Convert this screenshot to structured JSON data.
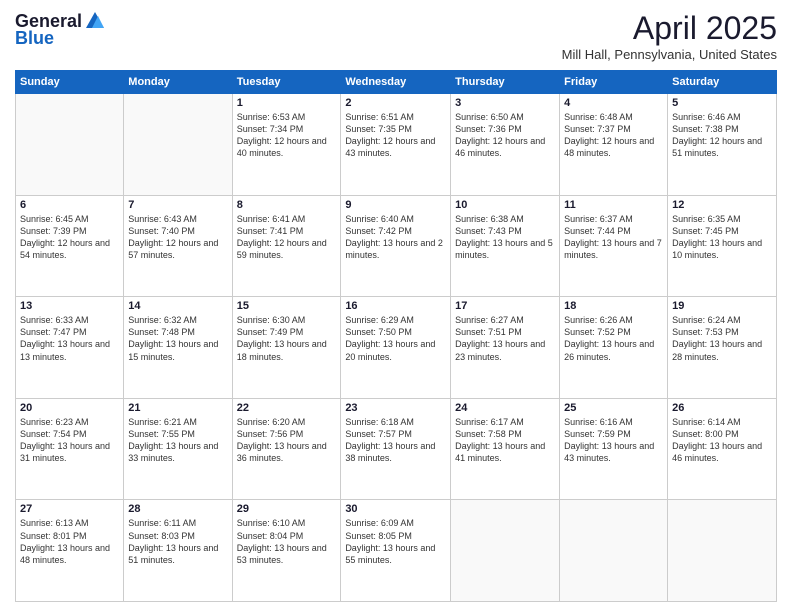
{
  "header": {
    "logo_line1": "General",
    "logo_line2": "Blue",
    "title": "April 2025",
    "subtitle": "Mill Hall, Pennsylvania, United States"
  },
  "days_of_week": [
    "Sunday",
    "Monday",
    "Tuesday",
    "Wednesday",
    "Thursday",
    "Friday",
    "Saturday"
  ],
  "weeks": [
    [
      {
        "day": "",
        "info": ""
      },
      {
        "day": "",
        "info": ""
      },
      {
        "day": "1",
        "info": "Sunrise: 6:53 AM\nSunset: 7:34 PM\nDaylight: 12 hours and 40 minutes."
      },
      {
        "day": "2",
        "info": "Sunrise: 6:51 AM\nSunset: 7:35 PM\nDaylight: 12 hours and 43 minutes."
      },
      {
        "day": "3",
        "info": "Sunrise: 6:50 AM\nSunset: 7:36 PM\nDaylight: 12 hours and 46 minutes."
      },
      {
        "day": "4",
        "info": "Sunrise: 6:48 AM\nSunset: 7:37 PM\nDaylight: 12 hours and 48 minutes."
      },
      {
        "day": "5",
        "info": "Sunrise: 6:46 AM\nSunset: 7:38 PM\nDaylight: 12 hours and 51 minutes."
      }
    ],
    [
      {
        "day": "6",
        "info": "Sunrise: 6:45 AM\nSunset: 7:39 PM\nDaylight: 12 hours and 54 minutes."
      },
      {
        "day": "7",
        "info": "Sunrise: 6:43 AM\nSunset: 7:40 PM\nDaylight: 12 hours and 57 minutes."
      },
      {
        "day": "8",
        "info": "Sunrise: 6:41 AM\nSunset: 7:41 PM\nDaylight: 12 hours and 59 minutes."
      },
      {
        "day": "9",
        "info": "Sunrise: 6:40 AM\nSunset: 7:42 PM\nDaylight: 13 hours and 2 minutes."
      },
      {
        "day": "10",
        "info": "Sunrise: 6:38 AM\nSunset: 7:43 PM\nDaylight: 13 hours and 5 minutes."
      },
      {
        "day": "11",
        "info": "Sunrise: 6:37 AM\nSunset: 7:44 PM\nDaylight: 13 hours and 7 minutes."
      },
      {
        "day": "12",
        "info": "Sunrise: 6:35 AM\nSunset: 7:45 PM\nDaylight: 13 hours and 10 minutes."
      }
    ],
    [
      {
        "day": "13",
        "info": "Sunrise: 6:33 AM\nSunset: 7:47 PM\nDaylight: 13 hours and 13 minutes."
      },
      {
        "day": "14",
        "info": "Sunrise: 6:32 AM\nSunset: 7:48 PM\nDaylight: 13 hours and 15 minutes."
      },
      {
        "day": "15",
        "info": "Sunrise: 6:30 AM\nSunset: 7:49 PM\nDaylight: 13 hours and 18 minutes."
      },
      {
        "day": "16",
        "info": "Sunrise: 6:29 AM\nSunset: 7:50 PM\nDaylight: 13 hours and 20 minutes."
      },
      {
        "day": "17",
        "info": "Sunrise: 6:27 AM\nSunset: 7:51 PM\nDaylight: 13 hours and 23 minutes."
      },
      {
        "day": "18",
        "info": "Sunrise: 6:26 AM\nSunset: 7:52 PM\nDaylight: 13 hours and 26 minutes."
      },
      {
        "day": "19",
        "info": "Sunrise: 6:24 AM\nSunset: 7:53 PM\nDaylight: 13 hours and 28 minutes."
      }
    ],
    [
      {
        "day": "20",
        "info": "Sunrise: 6:23 AM\nSunset: 7:54 PM\nDaylight: 13 hours and 31 minutes."
      },
      {
        "day": "21",
        "info": "Sunrise: 6:21 AM\nSunset: 7:55 PM\nDaylight: 13 hours and 33 minutes."
      },
      {
        "day": "22",
        "info": "Sunrise: 6:20 AM\nSunset: 7:56 PM\nDaylight: 13 hours and 36 minutes."
      },
      {
        "day": "23",
        "info": "Sunrise: 6:18 AM\nSunset: 7:57 PM\nDaylight: 13 hours and 38 minutes."
      },
      {
        "day": "24",
        "info": "Sunrise: 6:17 AM\nSunset: 7:58 PM\nDaylight: 13 hours and 41 minutes."
      },
      {
        "day": "25",
        "info": "Sunrise: 6:16 AM\nSunset: 7:59 PM\nDaylight: 13 hours and 43 minutes."
      },
      {
        "day": "26",
        "info": "Sunrise: 6:14 AM\nSunset: 8:00 PM\nDaylight: 13 hours and 46 minutes."
      }
    ],
    [
      {
        "day": "27",
        "info": "Sunrise: 6:13 AM\nSunset: 8:01 PM\nDaylight: 13 hours and 48 minutes."
      },
      {
        "day": "28",
        "info": "Sunrise: 6:11 AM\nSunset: 8:03 PM\nDaylight: 13 hours and 51 minutes."
      },
      {
        "day": "29",
        "info": "Sunrise: 6:10 AM\nSunset: 8:04 PM\nDaylight: 13 hours and 53 minutes."
      },
      {
        "day": "30",
        "info": "Sunrise: 6:09 AM\nSunset: 8:05 PM\nDaylight: 13 hours and 55 minutes."
      },
      {
        "day": "",
        "info": ""
      },
      {
        "day": "",
        "info": ""
      },
      {
        "day": "",
        "info": ""
      }
    ]
  ]
}
